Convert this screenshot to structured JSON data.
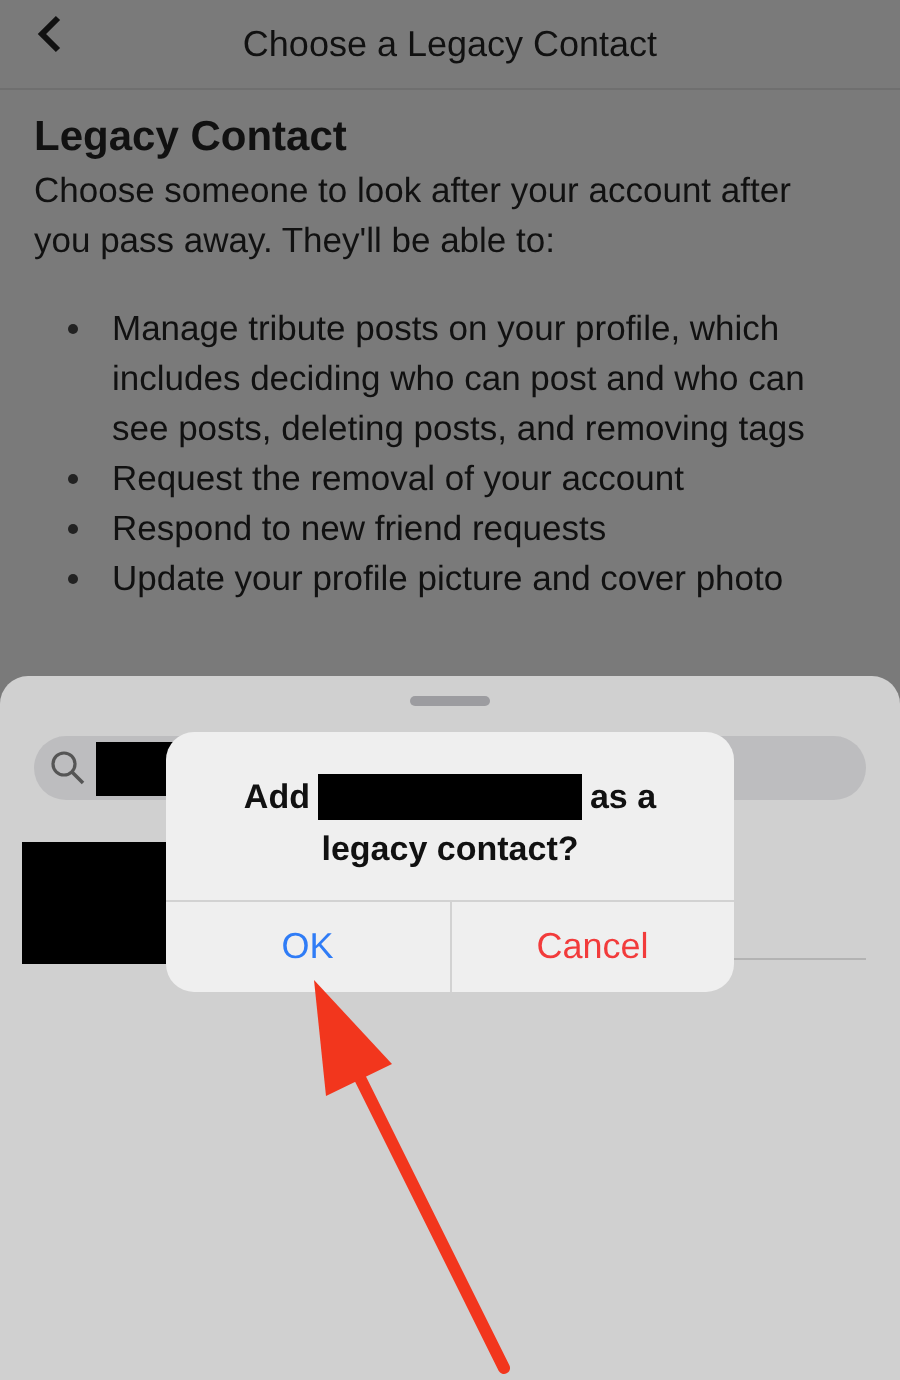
{
  "header": {
    "title": "Choose a Legacy Contact"
  },
  "section": {
    "heading": "Legacy Contact",
    "intro": "Choose someone to look after your account after you pass away. They'll be able to:",
    "bullets": [
      "Manage tribute posts on your profile, which includes deciding who can post and who can see posts, deleting posts, and removing tags",
      "Request the removal of your account",
      "Respond to new friend requests",
      "Update your profile picture and cover photo"
    ]
  },
  "sheet": {
    "search": {
      "redacted": true
    },
    "result": {
      "redacted": true
    }
  },
  "dialog": {
    "title_start": "Add",
    "title_redacted": true,
    "title_middle": "as a",
    "title_end": "legacy contact?",
    "buttons": [
      {
        "label": "OK",
        "kind": "default"
      },
      {
        "label": "Cancel",
        "kind": "destructive"
      }
    ]
  },
  "annotations": [
    {
      "kind": "arrow"
    }
  ]
}
